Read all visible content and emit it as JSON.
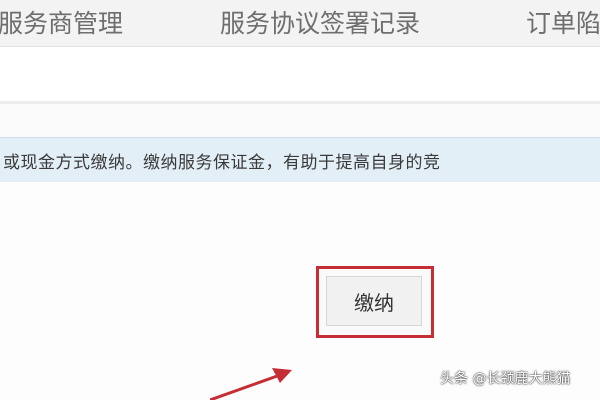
{
  "tabs": [
    {
      "label": "服务商管理"
    },
    {
      "label": "服务协议签署记录"
    },
    {
      "label": "订单陷"
    }
  ],
  "notice": {
    "text": "或现金方式缴纳。缴纳服务保证金，有助于提高自身的竞"
  },
  "pay_button": {
    "label": "缴纳"
  },
  "watermark": {
    "text": "头条 @长颈鹿大熊猫"
  },
  "colors": {
    "highlight": "#c62e35",
    "notice_background": "#e3eff7",
    "arrow": "#c62e35"
  }
}
